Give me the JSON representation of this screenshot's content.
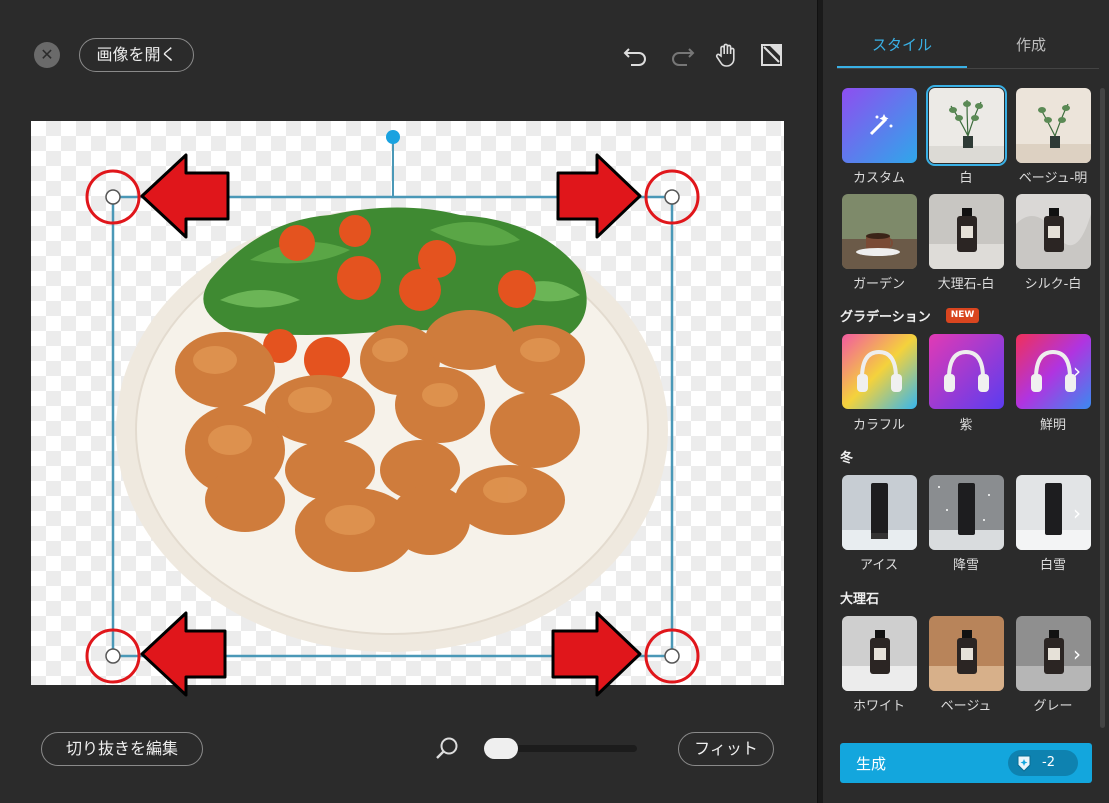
{
  "toolbar": {
    "open_image_label": "画像を開く",
    "icons": [
      "close-icon",
      "undo-icon",
      "redo-icon",
      "hand-icon",
      "eraser-icon"
    ]
  },
  "bottom": {
    "edit_cutout_label": "切り抜きを編集",
    "fit_label": "フィット",
    "zoom_level": 0.1
  },
  "tabs": [
    {
      "label": "スタイル",
      "active": true
    },
    {
      "label": "作成",
      "active": false
    }
  ],
  "styles": {
    "presets": [
      {
        "label": "カスタム",
        "selected": false
      },
      {
        "label": "白",
        "selected": true
      },
      {
        "label": "ベージュ-明",
        "selected": false
      },
      {
        "label": "ガーデン",
        "selected": false
      },
      {
        "label": "大理石-白",
        "selected": false
      },
      {
        "label": "シルク-白",
        "selected": false
      }
    ],
    "sections": [
      {
        "title": "グラデーション",
        "badge": "NEW",
        "items": [
          "カラフル",
          "紫",
          "鮮明"
        ]
      },
      {
        "title": "冬",
        "items": [
          "アイス",
          "降雪",
          "白雪"
        ]
      },
      {
        "title": "大理石",
        "items": [
          "ホワイト",
          "ベージュ",
          "グレー"
        ]
      }
    ]
  },
  "generate": {
    "label": "生成",
    "credit": "-2"
  },
  "colors": {
    "accent": "#39b0e5",
    "generate_button": "#13a6dd",
    "annotation_red": "#e0161b"
  }
}
